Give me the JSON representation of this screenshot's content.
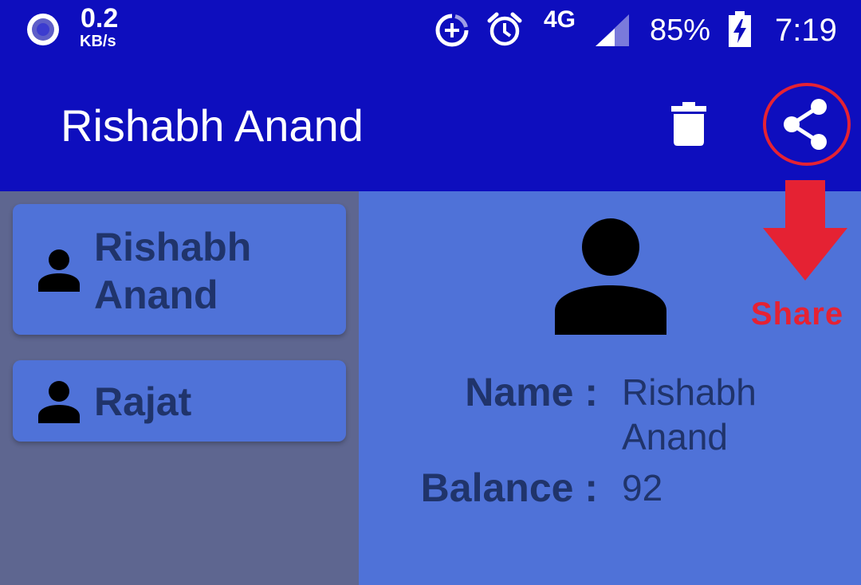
{
  "status_bar": {
    "net_speed_value": "0.2",
    "net_speed_unit": "KB/s",
    "network_type": "4G",
    "battery_percent": "85%",
    "time": "7:19",
    "icons": [
      "recording-icon",
      "data-saver-icon",
      "alarm-icon",
      "signal-icon",
      "battery-charging-icon"
    ]
  },
  "app_bar": {
    "title": "Rishabh Anand",
    "actions": [
      "delete-icon",
      "share-icon"
    ]
  },
  "customers": [
    {
      "name": "Rishabh Anand",
      "icon": "person-icon"
    },
    {
      "name": "Rajat",
      "icon": "person-icon"
    }
  ],
  "details": {
    "avatar_icon": "person-icon",
    "name_label": "Name :",
    "name_value": "Rishabh Anand",
    "balance_label": "Balance :",
    "balance_value": "92"
  },
  "annotation": {
    "label": "Share",
    "color": "#e52233"
  },
  "colors": {
    "primary": "#0e0ebe",
    "card": "#4f72d8",
    "list_background": "#5e6690",
    "text_dark": "#20346b"
  }
}
